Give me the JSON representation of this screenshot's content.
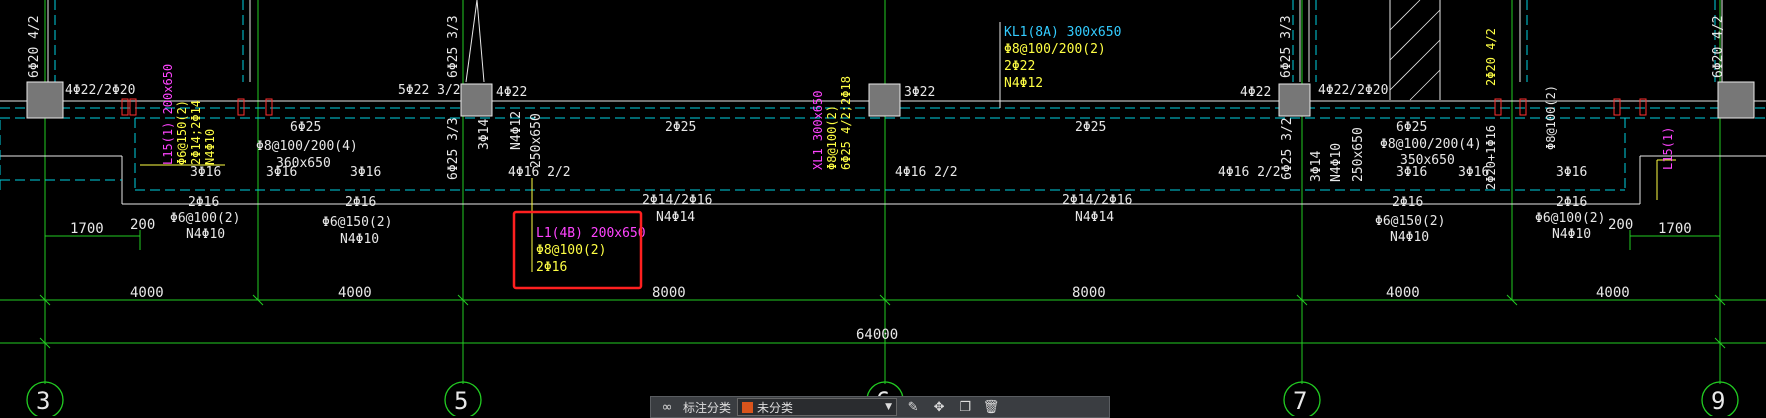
{
  "colors": {
    "background": "#000000",
    "axis_grid": "#22cc22",
    "beam_outline": "#e8e8e8",
    "beam_hidden_edge": "#00d0e0",
    "annotation_primary": "#ffff44",
    "annotation_beam_name": "#ff44ff",
    "annotation_cyan": "#33ccff",
    "column_fill": "#777777",
    "highlight_box": "#ff2020",
    "toolbar_swatch": "#d9541c"
  },
  "axes": [
    {
      "label": "3"
    },
    {
      "label": "5"
    },
    {
      "label": "6"
    },
    {
      "label": "7"
    },
    {
      "label": "9"
    }
  ],
  "dimensions": {
    "spans": [
      "4000",
      "4000",
      "8000",
      "8000",
      "4000",
      "4000"
    ],
    "total": "64000",
    "left_offsets": [
      "1700",
      "200"
    ],
    "right_offsets": [
      "200",
      "1700"
    ]
  },
  "kl1": {
    "name": "KL1(8A) 300x650",
    "stirrup": "Φ8@100/200(2)",
    "top": "2Φ22",
    "side": "N4Φ12"
  },
  "xl1": {
    "name": "XL1 300x650",
    "stirrup": "Φ8@100(2)",
    "top": "6Φ25 4/2;2Φ18"
  },
  "l1_highlight": {
    "name": "L1(4B) 200x650",
    "stirrup": "Φ8@100(2)",
    "bottom": "2Φ16"
  },
  "l15": {
    "name": "L15(1) 200x650",
    "stirrup": "Φ6@150(2)",
    "top": "2Φ14;2Φ14",
    "side": "N4Φ10",
    "name_short": "L15(1)"
  },
  "right_side": {
    "top_pair": "2Φ20 4/2",
    "mid": "2Φ20+1Φ16",
    "stirrup": "Φ8@100(2)"
  },
  "top_rebar": {
    "a": "4Φ22/2Φ20",
    "b": "5Φ22 3/2",
    "c": "4Φ22",
    "d": "3Φ22",
    "e": "4Φ22",
    "f": "4Φ22/2Φ20",
    "left_vert": "6Φ20 4/2",
    "right_vert": "6Φ20 4/2",
    "vert_col5": "6Φ25 3/3",
    "vert_col7": "6Φ25 3/3"
  },
  "span_labels": {
    "s1_top": "6Φ25",
    "s1_stirrup": "Φ8@100/200(4)",
    "s1_size": "360x650",
    "s1_bot_a": "3Φ16",
    "s1_bot_b": "3Φ16",
    "s2_bot": "3Φ16",
    "s3_top": "2Φ25",
    "s3_bot": "4Φ16 2/2",
    "s4_top": "2Φ25",
    "s4_bot": "4Φ16 2/2",
    "s5_top": "6Φ25",
    "s5_stirrup": "Φ8@100/200(4)",
    "s5_size": "350x650",
    "s5_bot_a": "3Φ16",
    "s5_bot_b": "3Φ16",
    "s6_bot": "3Φ16",
    "rot_col5_a": "6Φ25 3/3",
    "rot_col5_b": "3Φ14",
    "rot_col5_c": "N4Φ12",
    "rot_col5_d": "250x650",
    "rot_col5_e": "4Φ16 2/2",
    "rot_col6_a": "4Φ16 2/2",
    "rot_col7_a": "6Φ25 3/2",
    "rot_col7_b": "3Φ14",
    "rot_col7_c": "N4Φ10",
    "rot_col7_d": "250x650",
    "rot_col7_e": "4Φ16 2/2"
  },
  "secondary": {
    "a_top": "2Φ16",
    "a_stirrup": "Φ6@100(2)",
    "a_side": "N4Φ10",
    "b_top": "2Φ16",
    "b_stirrup": "Φ6@150(2)",
    "b_side": "N4Φ10",
    "c_top": "2Φ14/2Φ16",
    "c_side": "N4Φ14",
    "d_top": "2Φ14/2Φ16",
    "d_side": "N4Φ14",
    "e_top": "2Φ16",
    "e_stirrup": "Φ6@150(2)",
    "e_side": "N4Φ10",
    "f_top": "2Φ16",
    "f_stirrup": "Φ6@100(2)",
    "f_side": "N4Φ10"
  },
  "toolbar": {
    "label": "标注分类",
    "selected": "未分类",
    "icon_left": "infinity-icon",
    "icons_right": [
      "pen-icon",
      "move-icon",
      "copy-icon",
      "delete-icon"
    ]
  }
}
